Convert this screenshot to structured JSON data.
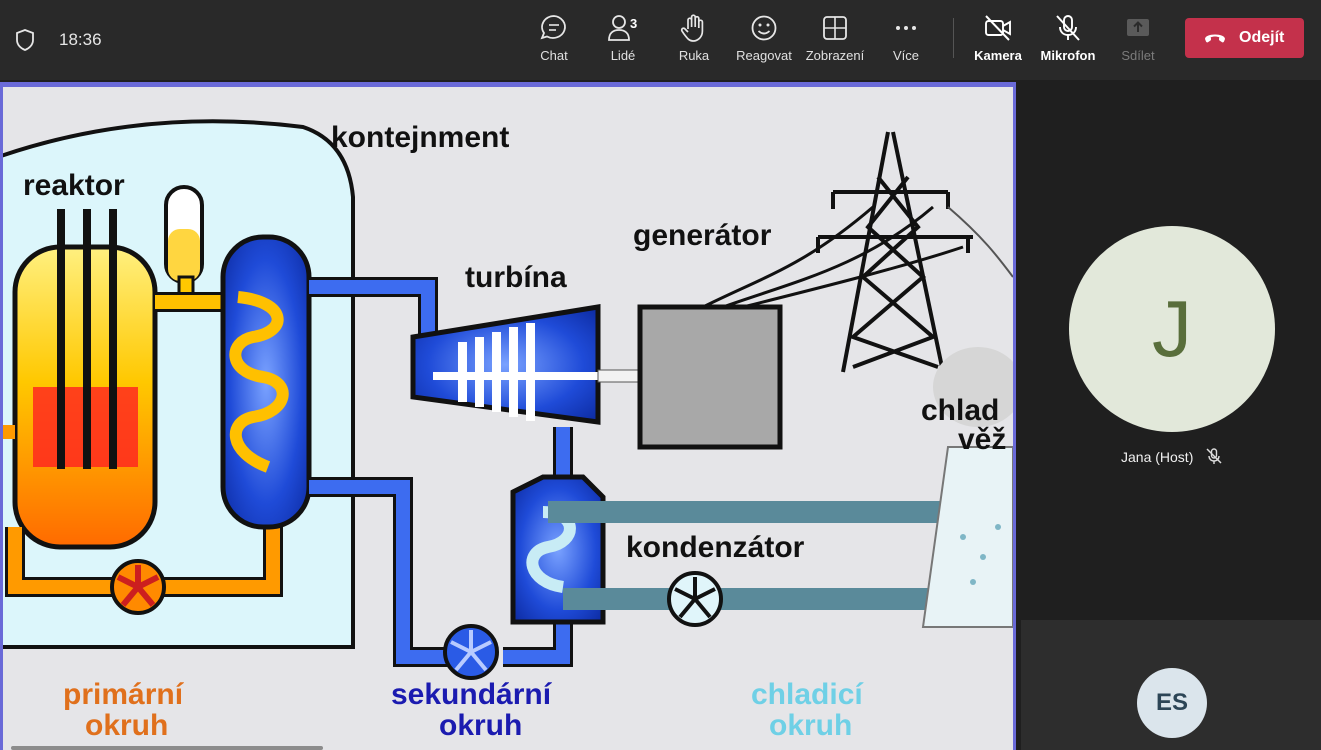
{
  "topbar": {
    "time": "18:36",
    "people_count": "3",
    "buttons": {
      "chat": "Chat",
      "people": "Lidé",
      "hand": "Ruka",
      "react": "Reagovat",
      "view": "Zobrazení",
      "more": "Více",
      "camera": "Kamera",
      "mic": "Mikrofon",
      "share": "Sdílet"
    },
    "leave": "Odejít"
  },
  "diagram": {
    "containment": "kontejnment",
    "reactor": "reaktor",
    "generator": "generátor",
    "turbine": "turbína",
    "cooling_tower_1": "chlad",
    "cooling_tower_2": "věž",
    "condenser": "kondenzátor",
    "primary_1": "primární",
    "primary_2": "okruh",
    "secondary_1": "sekundární",
    "secondary_2": "okruh",
    "cooling_1": "chladicí",
    "cooling_2": "okruh"
  },
  "participants": {
    "main": {
      "initial": "J",
      "name": "Jana (Host)"
    },
    "other": {
      "initials": "ES"
    }
  },
  "colors": {
    "leave": "#c4314b",
    "stage_border": "#6a6ad8",
    "primary_text": "#e0701c",
    "secondary_text": "#1b1bb0",
    "cooling_text": "#6fd0e6"
  }
}
